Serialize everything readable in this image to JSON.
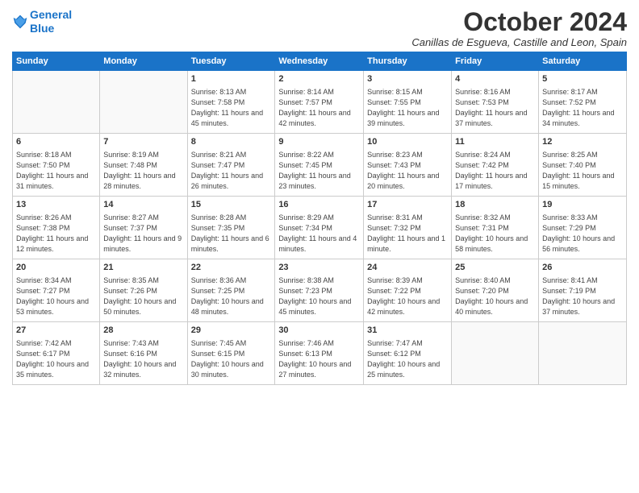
{
  "header": {
    "logo_line1": "General",
    "logo_line2": "Blue",
    "month_title": "October 2024",
    "subtitle": "Canillas de Esgueva, Castille and Leon, Spain"
  },
  "weekdays": [
    "Sunday",
    "Monday",
    "Tuesday",
    "Wednesday",
    "Thursday",
    "Friday",
    "Saturday"
  ],
  "weeks": [
    [
      {
        "day": "",
        "info": ""
      },
      {
        "day": "",
        "info": ""
      },
      {
        "day": "1",
        "info": "Sunrise: 8:13 AM\nSunset: 7:58 PM\nDaylight: 11 hours and 45 minutes."
      },
      {
        "day": "2",
        "info": "Sunrise: 8:14 AM\nSunset: 7:57 PM\nDaylight: 11 hours and 42 minutes."
      },
      {
        "day": "3",
        "info": "Sunrise: 8:15 AM\nSunset: 7:55 PM\nDaylight: 11 hours and 39 minutes."
      },
      {
        "day": "4",
        "info": "Sunrise: 8:16 AM\nSunset: 7:53 PM\nDaylight: 11 hours and 37 minutes."
      },
      {
        "day": "5",
        "info": "Sunrise: 8:17 AM\nSunset: 7:52 PM\nDaylight: 11 hours and 34 minutes."
      }
    ],
    [
      {
        "day": "6",
        "info": "Sunrise: 8:18 AM\nSunset: 7:50 PM\nDaylight: 11 hours and 31 minutes."
      },
      {
        "day": "7",
        "info": "Sunrise: 8:19 AM\nSunset: 7:48 PM\nDaylight: 11 hours and 28 minutes."
      },
      {
        "day": "8",
        "info": "Sunrise: 8:21 AM\nSunset: 7:47 PM\nDaylight: 11 hours and 26 minutes."
      },
      {
        "day": "9",
        "info": "Sunrise: 8:22 AM\nSunset: 7:45 PM\nDaylight: 11 hours and 23 minutes."
      },
      {
        "day": "10",
        "info": "Sunrise: 8:23 AM\nSunset: 7:43 PM\nDaylight: 11 hours and 20 minutes."
      },
      {
        "day": "11",
        "info": "Sunrise: 8:24 AM\nSunset: 7:42 PM\nDaylight: 11 hours and 17 minutes."
      },
      {
        "day": "12",
        "info": "Sunrise: 8:25 AM\nSunset: 7:40 PM\nDaylight: 11 hours and 15 minutes."
      }
    ],
    [
      {
        "day": "13",
        "info": "Sunrise: 8:26 AM\nSunset: 7:38 PM\nDaylight: 11 hours and 12 minutes."
      },
      {
        "day": "14",
        "info": "Sunrise: 8:27 AM\nSunset: 7:37 PM\nDaylight: 11 hours and 9 minutes."
      },
      {
        "day": "15",
        "info": "Sunrise: 8:28 AM\nSunset: 7:35 PM\nDaylight: 11 hours and 6 minutes."
      },
      {
        "day": "16",
        "info": "Sunrise: 8:29 AM\nSunset: 7:34 PM\nDaylight: 11 hours and 4 minutes."
      },
      {
        "day": "17",
        "info": "Sunrise: 8:31 AM\nSunset: 7:32 PM\nDaylight: 11 hours and 1 minute."
      },
      {
        "day": "18",
        "info": "Sunrise: 8:32 AM\nSunset: 7:31 PM\nDaylight: 10 hours and 58 minutes."
      },
      {
        "day": "19",
        "info": "Sunrise: 8:33 AM\nSunset: 7:29 PM\nDaylight: 10 hours and 56 minutes."
      }
    ],
    [
      {
        "day": "20",
        "info": "Sunrise: 8:34 AM\nSunset: 7:27 PM\nDaylight: 10 hours and 53 minutes."
      },
      {
        "day": "21",
        "info": "Sunrise: 8:35 AM\nSunset: 7:26 PM\nDaylight: 10 hours and 50 minutes."
      },
      {
        "day": "22",
        "info": "Sunrise: 8:36 AM\nSunset: 7:25 PM\nDaylight: 10 hours and 48 minutes."
      },
      {
        "day": "23",
        "info": "Sunrise: 8:38 AM\nSunset: 7:23 PM\nDaylight: 10 hours and 45 minutes."
      },
      {
        "day": "24",
        "info": "Sunrise: 8:39 AM\nSunset: 7:22 PM\nDaylight: 10 hours and 42 minutes."
      },
      {
        "day": "25",
        "info": "Sunrise: 8:40 AM\nSunset: 7:20 PM\nDaylight: 10 hours and 40 minutes."
      },
      {
        "day": "26",
        "info": "Sunrise: 8:41 AM\nSunset: 7:19 PM\nDaylight: 10 hours and 37 minutes."
      }
    ],
    [
      {
        "day": "27",
        "info": "Sunrise: 7:42 AM\nSunset: 6:17 PM\nDaylight: 10 hours and 35 minutes."
      },
      {
        "day": "28",
        "info": "Sunrise: 7:43 AM\nSunset: 6:16 PM\nDaylight: 10 hours and 32 minutes."
      },
      {
        "day": "29",
        "info": "Sunrise: 7:45 AM\nSunset: 6:15 PM\nDaylight: 10 hours and 30 minutes."
      },
      {
        "day": "30",
        "info": "Sunrise: 7:46 AM\nSunset: 6:13 PM\nDaylight: 10 hours and 27 minutes."
      },
      {
        "day": "31",
        "info": "Sunrise: 7:47 AM\nSunset: 6:12 PM\nDaylight: 10 hours and 25 minutes."
      },
      {
        "day": "",
        "info": ""
      },
      {
        "day": "",
        "info": ""
      }
    ]
  ]
}
